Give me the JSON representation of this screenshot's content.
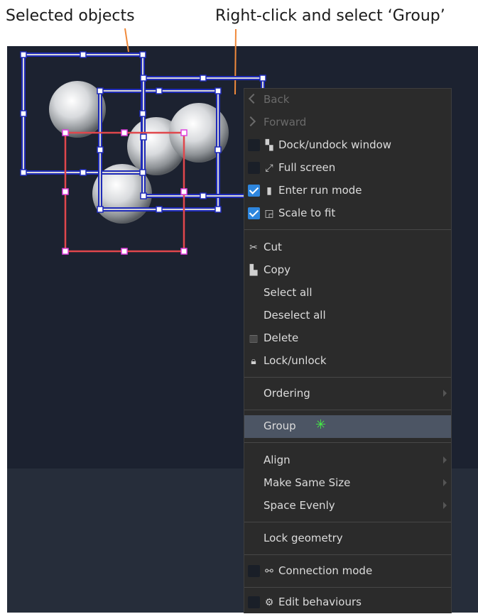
{
  "annotations": {
    "selected_objects": "Selected objects",
    "right_click": "Right-click and select ‘Group’"
  },
  "menu": {
    "back": "Back",
    "forward": "Forward",
    "dock_undock": "Dock/undock window",
    "full_screen": "Full screen",
    "enter_run_mode": "Enter run mode",
    "scale_to_fit": "Scale to fit",
    "cut": "Cut",
    "copy": "Copy",
    "select_all": "Select all",
    "deselect_all": "Deselect all",
    "delete": "Delete",
    "lock_unlock": "Lock/unlock",
    "ordering": "Ordering",
    "group": "Group",
    "align": "Align",
    "make_same_size": "Make Same Size",
    "space_evenly": "Space Evenly",
    "lock_geometry": "Lock geometry",
    "connection_mode": "Connection mode",
    "edit_behaviours": "Edit behaviours"
  },
  "state": {
    "dock_undock_checked": false,
    "full_screen_checked": false,
    "enter_run_mode_checked": true,
    "scale_to_fit_checked": true,
    "connection_mode_checked": false,
    "edit_behaviours_checked": false,
    "highlighted_item": "Group"
  },
  "colors": {
    "canvas": "#1c2230",
    "menu_bg": "#2b2b2b",
    "highlight": "#4c5564",
    "selection_blue": "#1f2bb8",
    "selection_red": "#e0474c",
    "handle_pink": "#e040e0",
    "annotation_line": "#f08a3c"
  }
}
